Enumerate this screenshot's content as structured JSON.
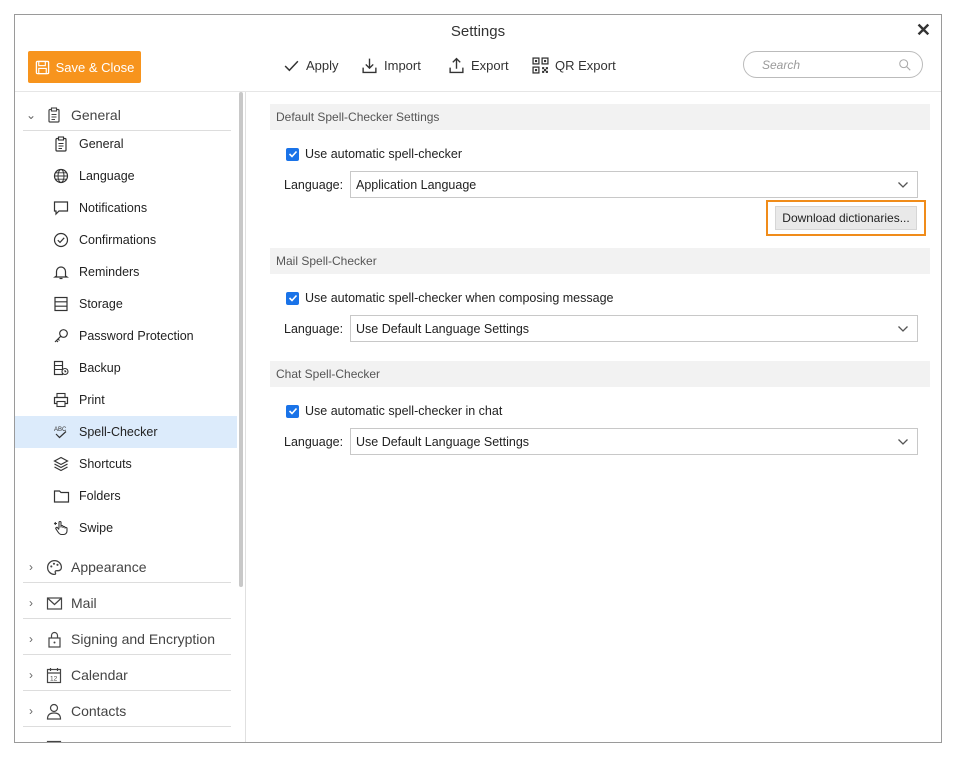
{
  "window": {
    "title": "Settings",
    "close_glyph": "✕"
  },
  "toolbar": {
    "save_label": "Save & Close",
    "apply_label": "Apply",
    "import_label": "Import",
    "export_label": "Export",
    "qr_label": "QR Export",
    "search_placeholder": "Search"
  },
  "sidebar": {
    "general_group": "General",
    "items": [
      {
        "label": "General",
        "icon": "clipboard-icon"
      },
      {
        "label": "Language",
        "icon": "globe-icon"
      },
      {
        "label": "Notifications",
        "icon": "chat-bubble-icon"
      },
      {
        "label": "Confirmations",
        "icon": "check-circle-icon"
      },
      {
        "label": "Reminders",
        "icon": "bell-icon"
      },
      {
        "label": "Storage",
        "icon": "storage-icon"
      },
      {
        "label": "Password Protection",
        "icon": "key-icon"
      },
      {
        "label": "Backup",
        "icon": "backup-icon"
      },
      {
        "label": "Print",
        "icon": "printer-icon"
      },
      {
        "label": "Spell-Checker",
        "icon": "spellcheck-icon"
      },
      {
        "label": "Shortcuts",
        "icon": "layers-icon"
      },
      {
        "label": "Folders",
        "icon": "folder-icon"
      },
      {
        "label": "Swipe",
        "icon": "hand-pointer-icon"
      }
    ],
    "active_item": "Spell-Checker",
    "groups": [
      {
        "label": "Appearance",
        "icon": "palette-icon"
      },
      {
        "label": "Mail",
        "icon": "envelope-icon"
      },
      {
        "label": "Signing and Encryption",
        "icon": "lock-icon"
      },
      {
        "label": "Calendar",
        "icon": "calendar-icon"
      },
      {
        "label": "Contacts",
        "icon": "person-icon"
      }
    ]
  },
  "content": {
    "default_section": {
      "title": "Default Spell-Checker Settings",
      "checkbox_label": "Use automatic spell-checker",
      "language_label": "Language:",
      "language_value": "Application Language",
      "download_button": "Download dictionaries..."
    },
    "mail_section": {
      "title": "Mail Spell-Checker",
      "checkbox_label": "Use automatic spell-checker when composing message",
      "language_label": "Language:",
      "language_value": "Use Default Language Settings"
    },
    "chat_section": {
      "title": "Chat Spell-Checker",
      "checkbox_label": "Use automatic spell-checker in chat",
      "language_label": "Language:",
      "language_value": "Use Default Language Settings"
    }
  },
  "colors": {
    "accent": "#f7941d",
    "checkbox": "#1a73e8",
    "active_row": "#dcebfb",
    "highlight_border": "#f08c1a"
  }
}
